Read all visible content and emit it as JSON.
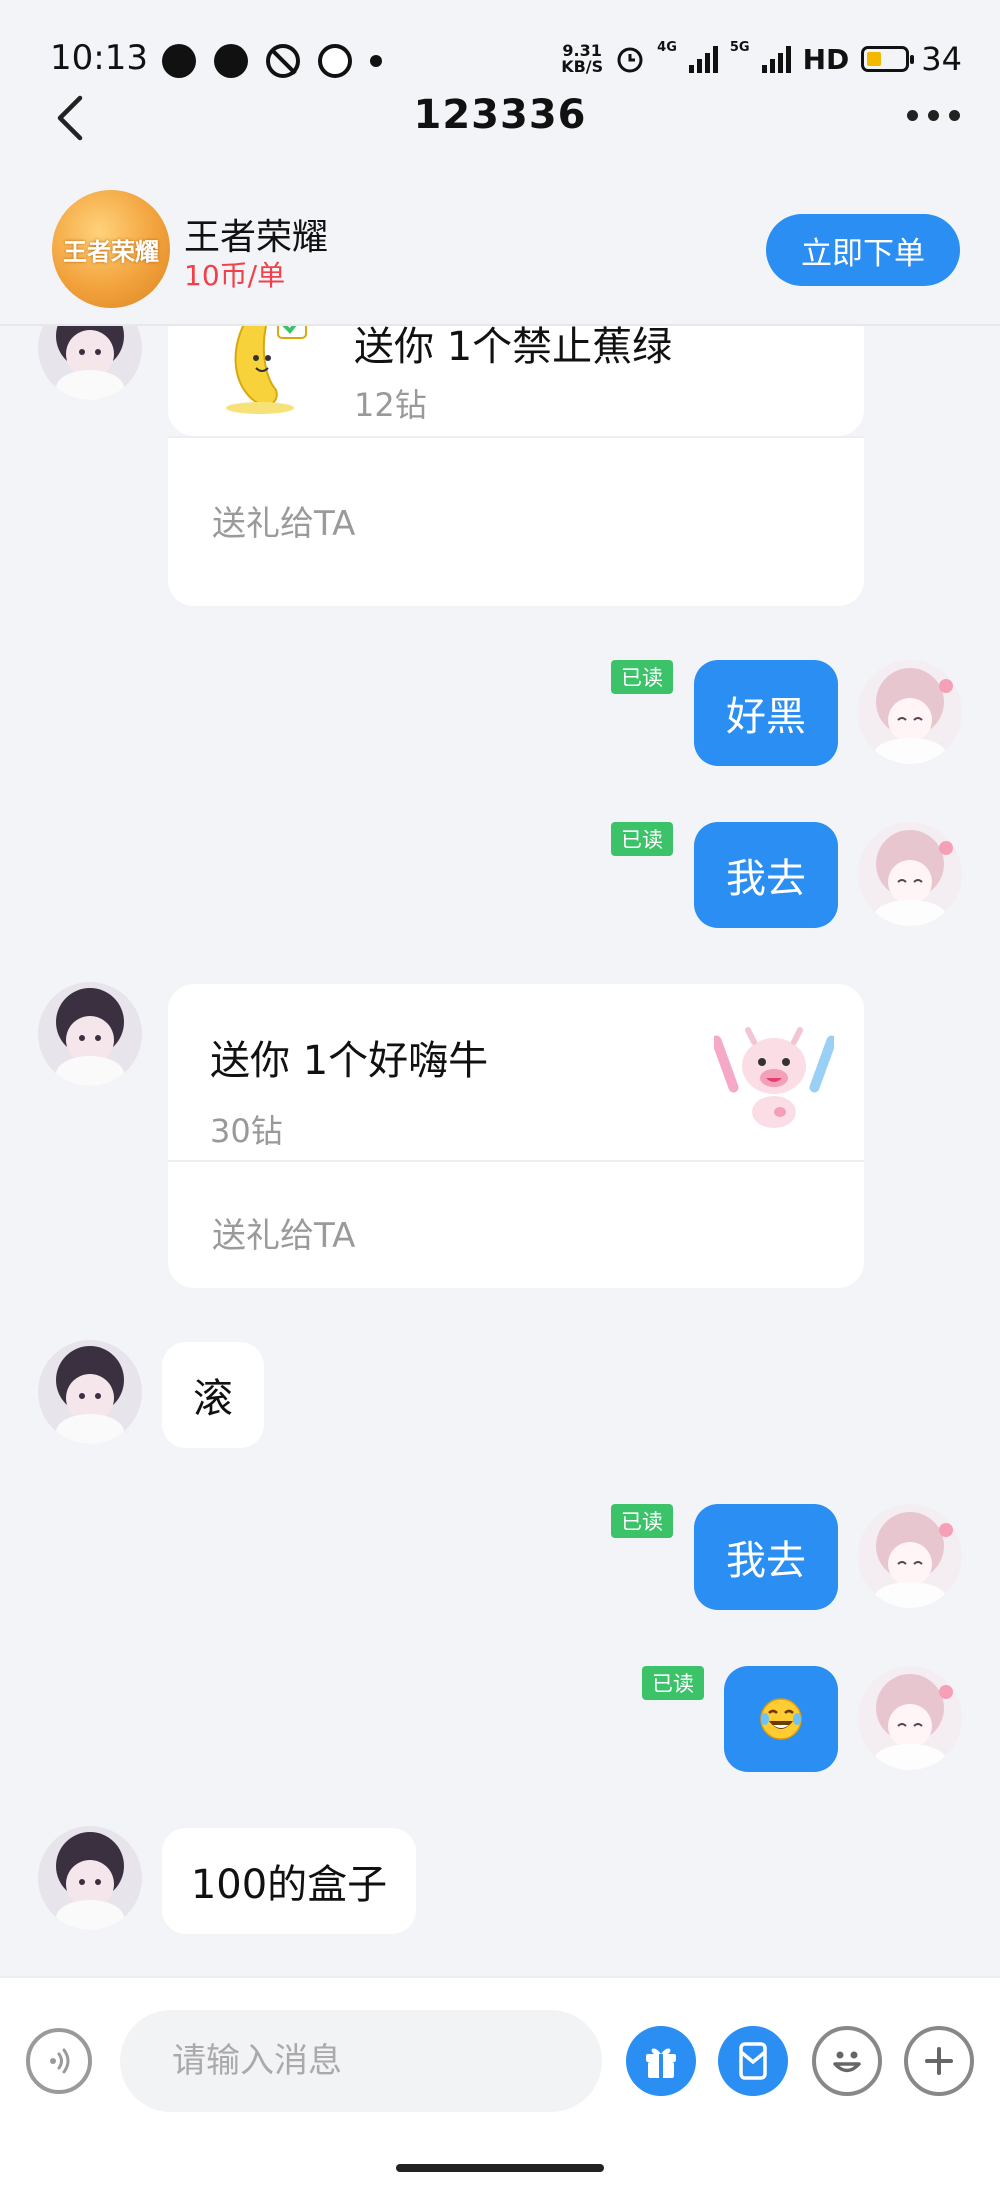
{
  "status_bar": {
    "time": "10:13",
    "net_speed_top": "9.31",
    "net_speed_bottom": "KB/S",
    "net_4g": "4G",
    "net_5g": "5G",
    "hd_label": "HD",
    "battery": "34"
  },
  "nav": {
    "title": "123336"
  },
  "order": {
    "game_name": "王者荣耀",
    "logo_text": "王者荣耀",
    "price": "10币/单",
    "order_button": "立即下单"
  },
  "messages": {
    "gift1": {
      "title": "送你 1个禁止蕉绿",
      "price": "12钻",
      "footer": "送礼给TA"
    },
    "out1": {
      "text": "好黑",
      "read": "已读"
    },
    "out2": {
      "text": "我去",
      "read": "已读"
    },
    "gift2": {
      "title": "送你 1个好嗨牛",
      "price": "30钻",
      "footer": "送礼给TA"
    },
    "in1": {
      "text": "滚"
    },
    "out3": {
      "text": "我去",
      "read": "已读"
    },
    "out4": {
      "text": "😂",
      "read": "已读"
    },
    "in2": {
      "text": "100的盒子"
    }
  },
  "input": {
    "placeholder": "请输入消息"
  },
  "colors": {
    "accent": "#2a8ef2",
    "read_tag": "#3cc36a",
    "price_red": "#f2404a"
  }
}
